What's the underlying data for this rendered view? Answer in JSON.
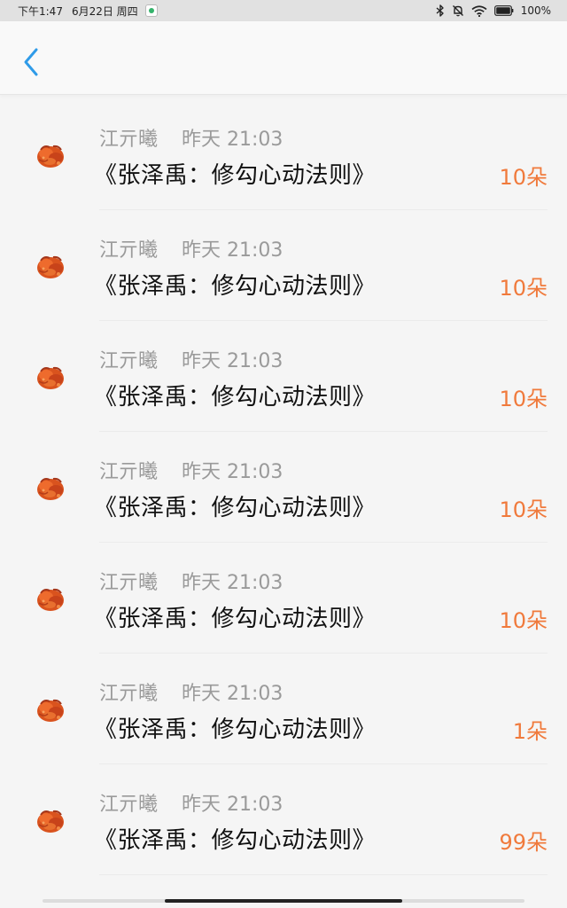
{
  "status_bar": {
    "time_text": "下午1:47",
    "date_text": "6月22日 周四",
    "battery_text": "100%"
  },
  "header": {
    "back_icon": "chevron-left-icon"
  },
  "colors": {
    "accent_back": "#2f9be8",
    "amount": "#f07a3c"
  },
  "gifts": [
    {
      "name": "江亓曦",
      "time": "昨天 21:03",
      "title": "《张泽禹：修勾心动法则》",
      "amount": "10朵"
    },
    {
      "name": "江亓曦",
      "time": "昨天 21:03",
      "title": "《张泽禹：修勾心动法则》",
      "amount": "10朵"
    },
    {
      "name": "江亓曦",
      "time": "昨天 21:03",
      "title": "《张泽禹：修勾心动法则》",
      "amount": "10朵"
    },
    {
      "name": "江亓曦",
      "time": "昨天 21:03",
      "title": "《张泽禹：修勾心动法则》",
      "amount": "10朵"
    },
    {
      "name": "江亓曦",
      "time": "昨天 21:03",
      "title": "《张泽禹：修勾心动法则》",
      "amount": "10朵"
    },
    {
      "name": "江亓曦",
      "time": "昨天 21:03",
      "title": "《张泽禹：修勾心动法则》",
      "amount": "1朵"
    },
    {
      "name": "江亓曦",
      "time": "昨天 21:03",
      "title": "《张泽禹：修勾心动法则》",
      "amount": "99朵"
    }
  ]
}
